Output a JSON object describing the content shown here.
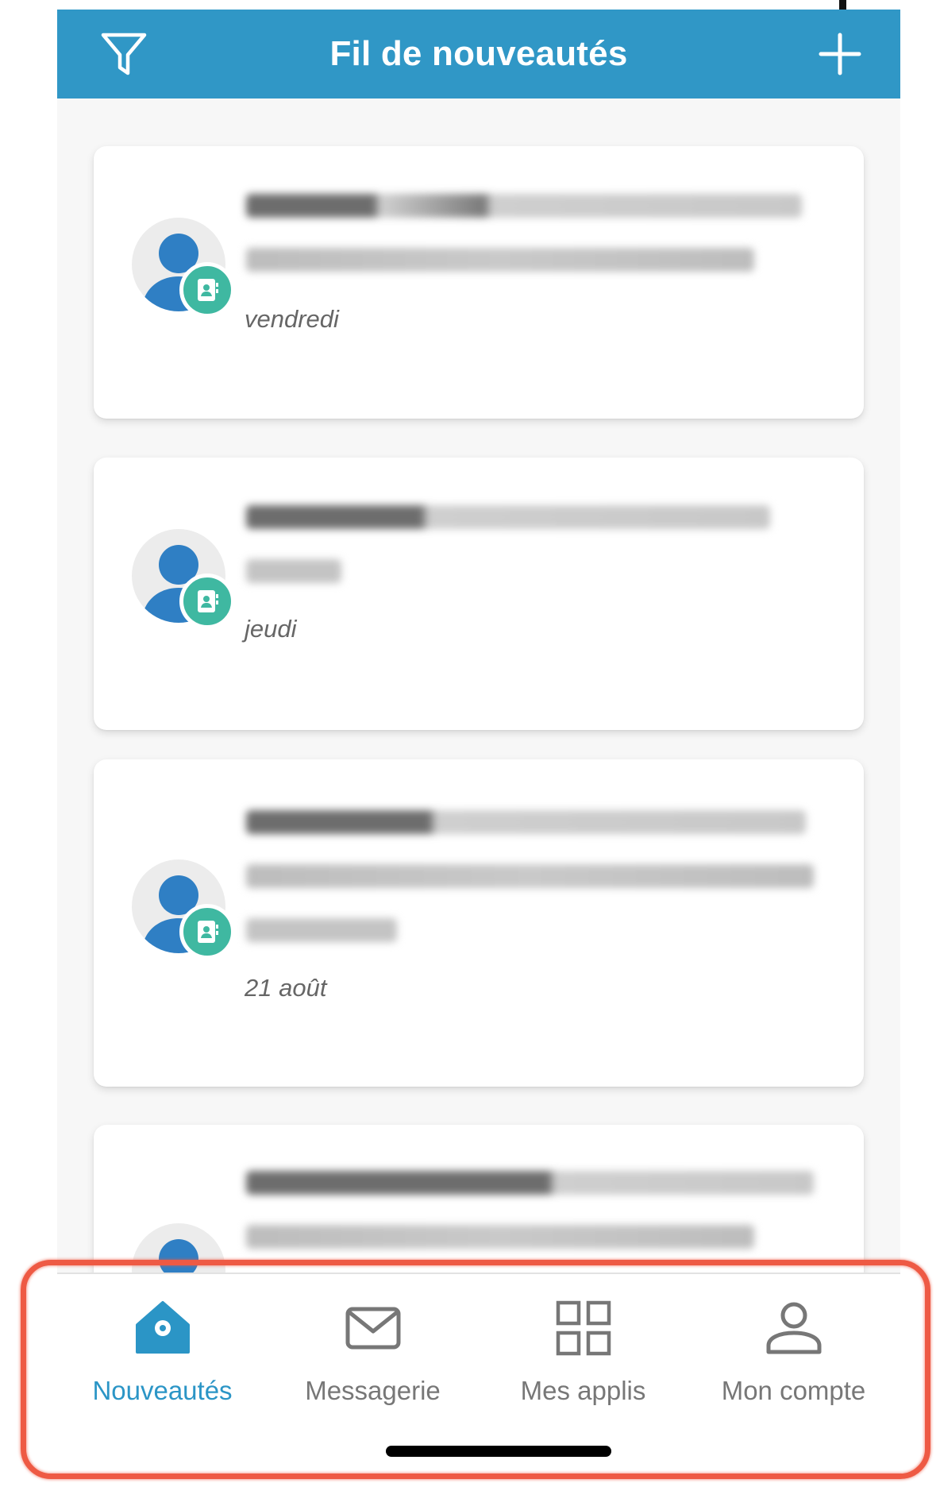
{
  "header": {
    "title": "Fil de nouveautés",
    "filter_icon": "filter-icon",
    "add_icon": "plus-icon",
    "color": "#3097c6"
  },
  "feed": {
    "items": [
      {
        "date": "vendredi"
      },
      {
        "date": "jeudi"
      },
      {
        "date": "21 août"
      },
      {
        "date": ""
      }
    ],
    "badge_icon": "contact-book-icon",
    "badge_color": "#3fb8a1",
    "avatar_icon": "person-icon",
    "avatar_color": "#2f7fc4"
  },
  "bottom_nav": {
    "items": [
      {
        "label": "Nouveautés",
        "icon": "home-icon",
        "active": true
      },
      {
        "label": "Messagerie",
        "icon": "mail-icon",
        "active": false
      },
      {
        "label": "Mes applis",
        "icon": "grid-icon",
        "active": false
      },
      {
        "label": "Mon compte",
        "icon": "user-icon",
        "active": false
      }
    ],
    "active_color": "#2b95c6",
    "inactive_color": "#777777"
  },
  "highlight_color": "#ee5a44"
}
